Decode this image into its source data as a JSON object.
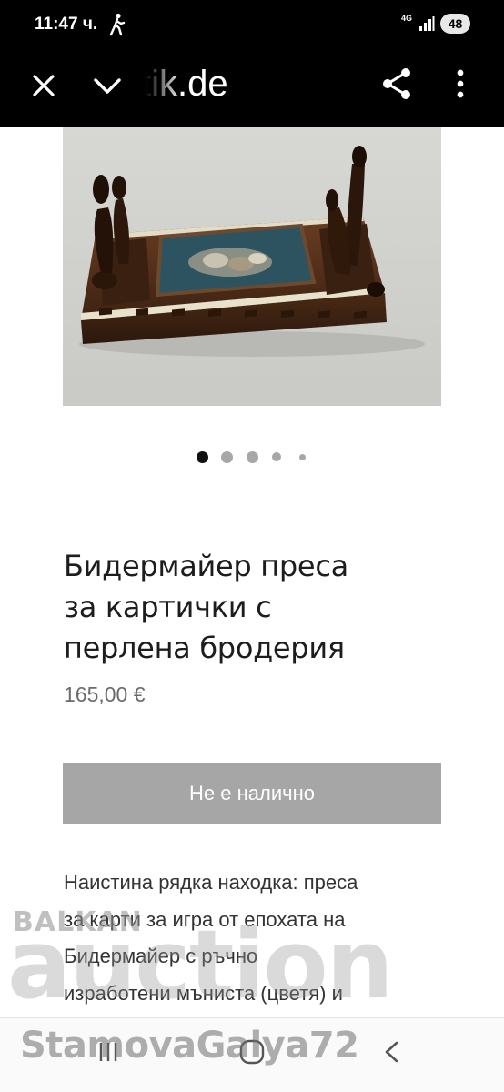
{
  "status_bar": {
    "time": "11:47 ч.",
    "network": "4G",
    "battery": "48",
    "icons": [
      "walking-icon",
      "signal-icon"
    ]
  },
  "toolbar": {
    "url": "tik.de",
    "icons": [
      "close-icon",
      "chevron-down-icon",
      "share-icon",
      "more-vert-icon"
    ]
  },
  "carousel": {
    "total": 5,
    "active_index": 0,
    "colors": {
      "active": "#111111",
      "inactive": "#a7a7a7"
    }
  },
  "product": {
    "title_lines": [
      "Бидермайер преса",
      "за картички с",
      "перлена бродерия"
    ],
    "price": "165,00 €",
    "button_label": "Не е налично",
    "description_lines": [
      "Наистина рядка находка: преса",
      "за карти за игра от епохата на",
      "Бидермайер с ръчно",
      "изработени мъниста (цветя) и"
    ]
  },
  "watermark": {
    "brand_top": "BALKAN",
    "brand_main": "auction",
    "user": "StamovaGalya72"
  },
  "colors": {
    "toolbar_bg": "#000000",
    "button_bg": "#a6a6a6",
    "title": "#1d1d1d",
    "price": "#6b6b6b"
  }
}
